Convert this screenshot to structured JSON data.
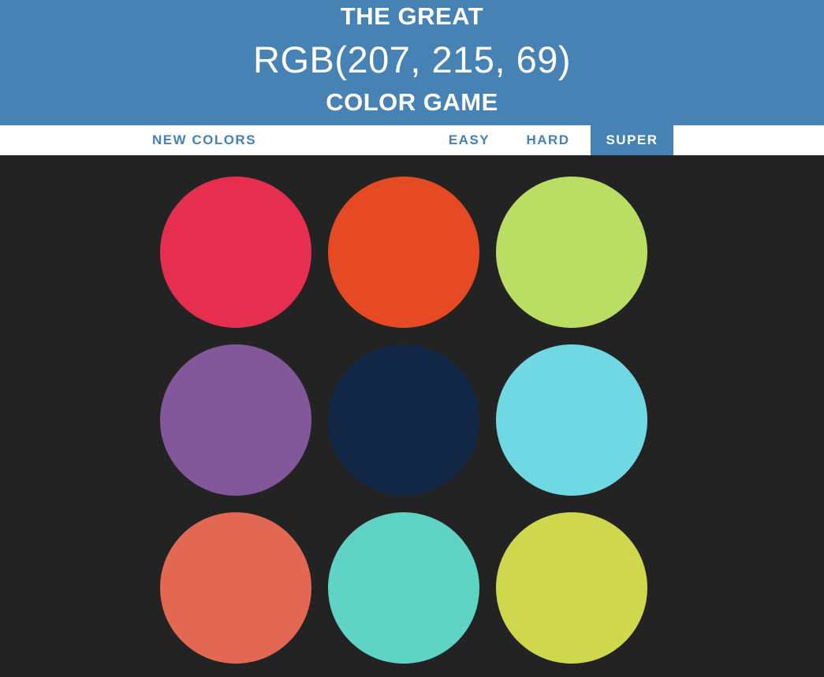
{
  "header": {
    "line1": "THE GREAT",
    "target_rgb": "RGB(207, 215, 69)",
    "line3": "COLOR GAME",
    "background_color": "#4682b4"
  },
  "controls": {
    "new_colors_label": "NEW COLORS",
    "modes": [
      {
        "label": "EASY",
        "selected": false
      },
      {
        "label": "HARD",
        "selected": false
      },
      {
        "label": "SUPER",
        "selected": true
      }
    ]
  },
  "board": {
    "background_color": "#232323",
    "squares": [
      {
        "color": "#e52e50"
      },
      {
        "color": "#e54a24"
      },
      {
        "color": "#badd63"
      },
      {
        "color": "#83589b"
      },
      {
        "color": "#122645"
      },
      {
        "color": "#6fd8e2"
      },
      {
        "color": "#e26853"
      },
      {
        "color": "#5fd3c4"
      },
      {
        "color": "#cfd74d"
      }
    ]
  }
}
